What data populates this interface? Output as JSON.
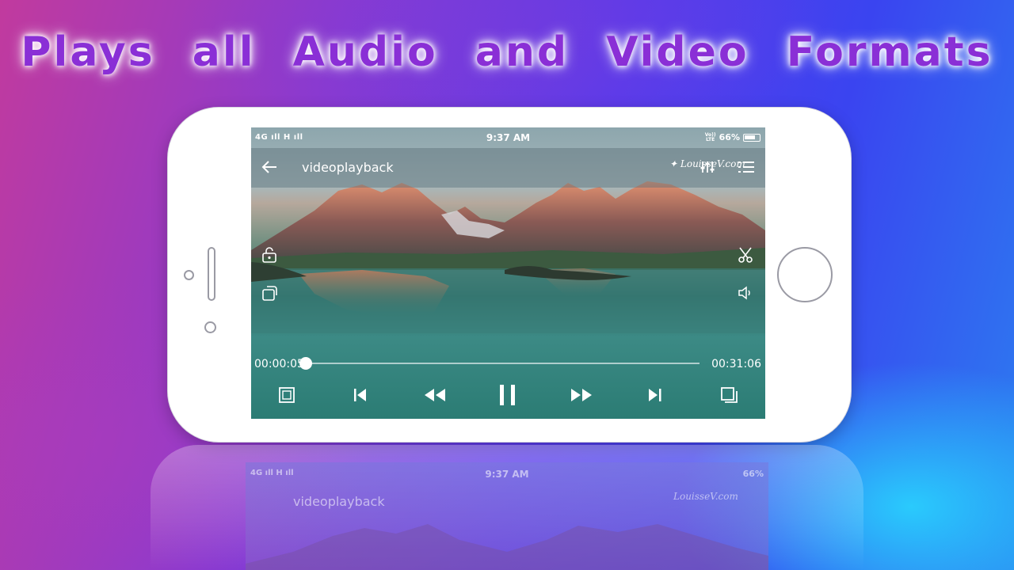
{
  "headline": "Plays all Audio and Video Formats",
  "status_bar": {
    "left": "4G ıll  H ıll",
    "time": "9:37 AM",
    "volte_top": "Vo))",
    "volte_bottom": "LTE",
    "battery": "66%"
  },
  "player": {
    "title": "videoplayback",
    "watermark": "LouisseV.com",
    "current_time": "00:00:05",
    "total_time": "00:31:06",
    "progress": 0.003
  },
  "icons": {
    "back": "back-arrow-icon",
    "equalizer": "equalizer-icon",
    "playlist": "playlist-icon",
    "lock": "unlock-icon",
    "rotate": "rotate-screen-icon",
    "cut": "scissors-icon",
    "volume": "volume-icon",
    "aspect": "aspect-ratio-icon",
    "previous": "skip-previous-icon",
    "rewind": "rewind-icon",
    "pause": "pause-icon",
    "forward": "fast-forward-icon",
    "next": "skip-next-icon",
    "popup": "popup-window-icon"
  },
  "colors": {
    "headline": "#8a2fd6",
    "accent_bg_start": "#c13a9e",
    "accent_bg_end": "#2c7df0"
  }
}
